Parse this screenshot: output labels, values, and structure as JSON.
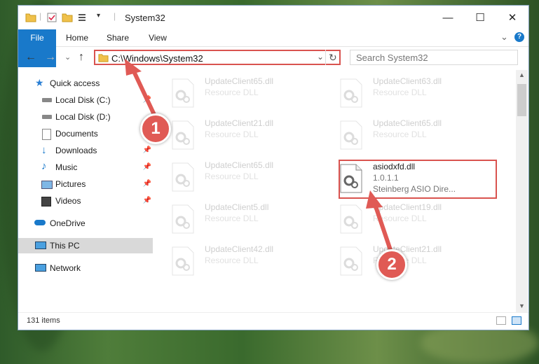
{
  "window": {
    "title": "System32",
    "controls": {
      "minimize": "—",
      "maximize": "☐",
      "close": "✕"
    }
  },
  "ribbon": {
    "tabs": [
      "File",
      "Home",
      "Share",
      "View"
    ],
    "expand": "⌄",
    "help": "?"
  },
  "nav": {
    "back": "←",
    "forward": "→",
    "recent": "⌄",
    "up": "↑",
    "address": "C:\\Windows\\System32",
    "address_dropdown": "⌄",
    "refresh": "↻",
    "search_placeholder": "Search System32"
  },
  "sidebar": {
    "items": [
      {
        "label": "Quick access",
        "icon": "star-icon",
        "pinned": false
      },
      {
        "label": "Local Disk (C:)",
        "icon": "drive-icon",
        "pinned": true
      },
      {
        "label": "Local Disk (D:)",
        "icon": "drive-icon",
        "pinned": false
      },
      {
        "label": "Documents",
        "icon": "documents-icon",
        "pinned": true
      },
      {
        "label": "Downloads",
        "icon": "download-icon",
        "pinned": true
      },
      {
        "label": "Music",
        "icon": "music-icon",
        "pinned": true
      },
      {
        "label": "Pictures",
        "icon": "pictures-icon",
        "pinned": true
      },
      {
        "label": "Videos",
        "icon": "videos-icon",
        "pinned": true
      },
      {
        "label": "OneDrive",
        "icon": "cloud-icon",
        "pinned": false
      },
      {
        "label": "This PC",
        "icon": "computer-icon",
        "pinned": false,
        "selected": true
      },
      {
        "label": "Network",
        "icon": "network-icon",
        "pinned": false
      }
    ],
    "pin_glyph": "📌"
  },
  "files": [
    {
      "name": "UpdateClient65.dll",
      "type": "Resource DLL"
    },
    {
      "name": "UpdateClient63.dll",
      "type": "Resource DLL"
    },
    {
      "name": "UpdateClient21.dll",
      "type": "Resource DLL"
    },
    {
      "name": "UpdateClient65.dll",
      "type": "Resource DLL"
    },
    {
      "name": "UpdateClient65.dll",
      "type": "Resource DLL"
    },
    {
      "name": "asiodxfd.dll",
      "version": "1.0.1.1",
      "description": "Steinberg ASIO Dire...",
      "highlighted": true
    },
    {
      "name": "UpdateClient5.dll",
      "type": "Resource DLL"
    },
    {
      "name": "UpdateClient19.dll",
      "type": "Resource DLL"
    },
    {
      "name": "UpdateClient42.dll",
      "type": "Resource DLL"
    },
    {
      "name": "UpdateClient21.dll",
      "type": "Resource DLL"
    }
  ],
  "status": {
    "item_count": "131 items"
  },
  "callouts": {
    "one": "1",
    "two": "2"
  },
  "colors": {
    "accent": "#1979ca",
    "highlight": "#d9534f",
    "selection": "#d9d9d9"
  }
}
